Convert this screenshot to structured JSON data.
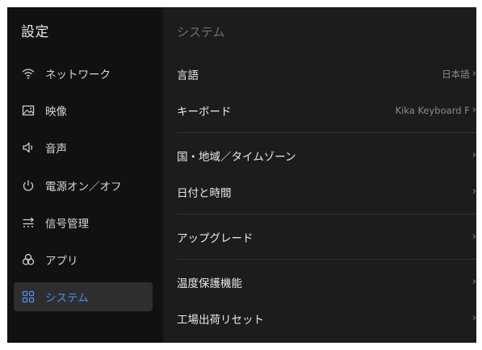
{
  "sidebar": {
    "title": "設定",
    "items": [
      {
        "label": "ネットワーク",
        "icon": "wifi-icon"
      },
      {
        "label": "映像",
        "icon": "picture-icon"
      },
      {
        "label": "音声",
        "icon": "speaker-icon"
      },
      {
        "label": "電源オン／オフ",
        "icon": "power-icon"
      },
      {
        "label": "信号管理",
        "icon": "signal-manage-icon"
      },
      {
        "label": "アプリ",
        "icon": "apps-icon"
      },
      {
        "label": "システム",
        "icon": "system-icon",
        "active": true
      }
    ]
  },
  "main": {
    "title": "システム",
    "rows": [
      {
        "label": "言語",
        "value": "日本語"
      },
      {
        "label": "キーボード",
        "value": "Kika Keyboard F"
      },
      {
        "label": "国・地域／タイムゾーン",
        "value": ""
      },
      {
        "label": "日付と時間",
        "value": ""
      },
      {
        "label": "アップグレード",
        "value": ""
      },
      {
        "label": "温度保護機能",
        "value": ""
      },
      {
        "label": "工場出荷リセット",
        "value": ""
      }
    ]
  },
  "colors": {
    "accent": "#4d8ff5",
    "sidebar_bg": "#111111",
    "content_bg": "#1c1c1c",
    "active_bg": "#2e2e2e"
  }
}
